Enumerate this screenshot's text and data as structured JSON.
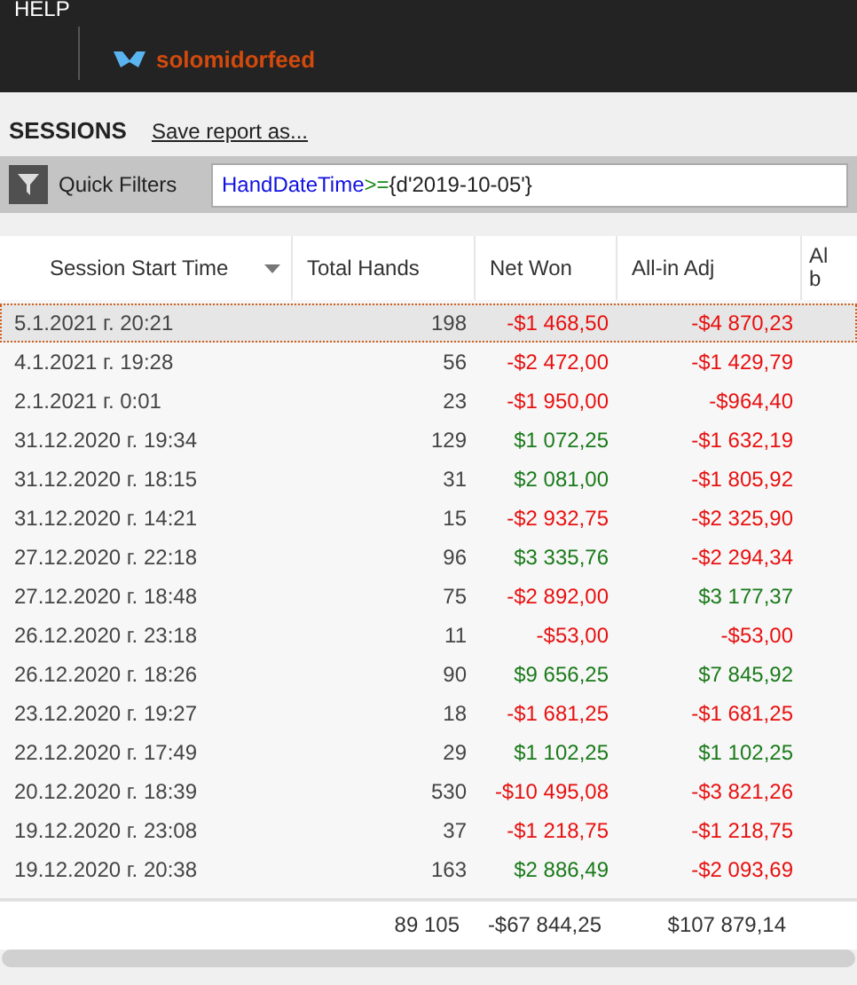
{
  "menu": {
    "label": "HELP"
  },
  "account": {
    "name": "solomidorfeed"
  },
  "report": {
    "title": "SESSIONS",
    "save_link": "Save report as..."
  },
  "quick_filters": {
    "label": "Quick Filters",
    "tokens": [
      {
        "kind": "field",
        "text": "HandDateTime"
      },
      {
        "kind": "operator",
        "text": ">="
      },
      {
        "kind": "value",
        "text": "{d'2019-10-05'}"
      }
    ]
  },
  "table": {
    "columns": [
      {
        "label": "Session Start Time",
        "sorted": true
      },
      {
        "label": "Total Hands",
        "sorted": false
      },
      {
        "label": "Net Won",
        "sorted": false
      },
      {
        "label": "All-in Adj",
        "sorted": false
      },
      {
        "label": "Al\nb",
        "sorted": false
      }
    ],
    "rows": [
      {
        "selected": true,
        "start": "5.1.2021 г. 20:21",
        "hands": "198",
        "net_won": {
          "text": "-$1 468,50",
          "color": "#e81010"
        },
        "allin_adj": {
          "text": "-$4 870,23",
          "color": "#e81010"
        }
      },
      {
        "selected": false,
        "start": "4.1.2021 г. 19:28",
        "hands": "56",
        "net_won": {
          "text": "-$2 472,00",
          "color": "#e81010"
        },
        "allin_adj": {
          "text": "-$1 429,79",
          "color": "#e81010"
        }
      },
      {
        "selected": false,
        "start": "2.1.2021 г. 0:01",
        "hands": "23",
        "net_won": {
          "text": "-$1 950,00",
          "color": "#e81010"
        },
        "allin_adj": {
          "text": "-$964,40",
          "color": "#e81010"
        }
      },
      {
        "selected": false,
        "start": "31.12.2020 г. 19:34",
        "hands": "129",
        "net_won": {
          "text": "$1 072,25",
          "color": "#1a7a1a"
        },
        "allin_adj": {
          "text": "-$1 632,19",
          "color": "#e81010"
        }
      },
      {
        "selected": false,
        "start": "31.12.2020 г. 18:15",
        "hands": "31",
        "net_won": {
          "text": "$2 081,00",
          "color": "#1a7a1a"
        },
        "allin_adj": {
          "text": "-$1 805,92",
          "color": "#e81010"
        }
      },
      {
        "selected": false,
        "start": "31.12.2020 г. 14:21",
        "hands": "15",
        "net_won": {
          "text": "-$2 932,75",
          "color": "#e81010"
        },
        "allin_adj": {
          "text": "-$2 325,90",
          "color": "#e81010"
        }
      },
      {
        "selected": false,
        "start": "27.12.2020 г. 22:18",
        "hands": "96",
        "net_won": {
          "text": "$3 335,76",
          "color": "#1a7a1a"
        },
        "allin_adj": {
          "text": "-$2 294,34",
          "color": "#e81010"
        }
      },
      {
        "selected": false,
        "start": "27.12.2020 г. 18:48",
        "hands": "75",
        "net_won": {
          "text": "-$2 892,00",
          "color": "#e81010"
        },
        "allin_adj": {
          "text": "$3 177,37",
          "color": "#1a7a1a"
        }
      },
      {
        "selected": false,
        "start": "26.12.2020 г. 23:18",
        "hands": "11",
        "net_won": {
          "text": "-$53,00",
          "color": "#e81010"
        },
        "allin_adj": {
          "text": "-$53,00",
          "color": "#e81010"
        }
      },
      {
        "selected": false,
        "start": "26.12.2020 г. 18:26",
        "hands": "90",
        "net_won": {
          "text": "$9 656,25",
          "color": "#1a7a1a"
        },
        "allin_adj": {
          "text": "$7 845,92",
          "color": "#1a7a1a"
        }
      },
      {
        "selected": false,
        "start": "23.12.2020 г. 19:27",
        "hands": "18",
        "net_won": {
          "text": "-$1 681,25",
          "color": "#e81010"
        },
        "allin_adj": {
          "text": "-$1 681,25",
          "color": "#e81010"
        }
      },
      {
        "selected": false,
        "start": "22.12.2020 г. 17:49",
        "hands": "29",
        "net_won": {
          "text": "$1 102,25",
          "color": "#1a7a1a"
        },
        "allin_adj": {
          "text": "$1 102,25",
          "color": "#1a7a1a"
        }
      },
      {
        "selected": false,
        "start": "20.12.2020 г. 18:39",
        "hands": "530",
        "net_won": {
          "text": "-$10 495,08",
          "color": "#e81010"
        },
        "allin_adj": {
          "text": "-$3 821,26",
          "color": "#e81010"
        }
      },
      {
        "selected": false,
        "start": "19.12.2020 г. 23:08",
        "hands": "37",
        "net_won": {
          "text": "-$1 218,75",
          "color": "#e81010"
        },
        "allin_adj": {
          "text": "-$1 218,75",
          "color": "#e81010"
        }
      },
      {
        "selected": false,
        "start": "19.12.2020 г. 20:38",
        "hands": "163",
        "net_won": {
          "text": "$2 886,49",
          "color": "#1a7a1a"
        },
        "allin_adj": {
          "text": "-$2 093,69",
          "color": "#e81010"
        }
      }
    ],
    "totals": {
      "hands": "89 105",
      "net_won": "-$67 844,25",
      "allin_adj": "$107 879,14"
    }
  }
}
